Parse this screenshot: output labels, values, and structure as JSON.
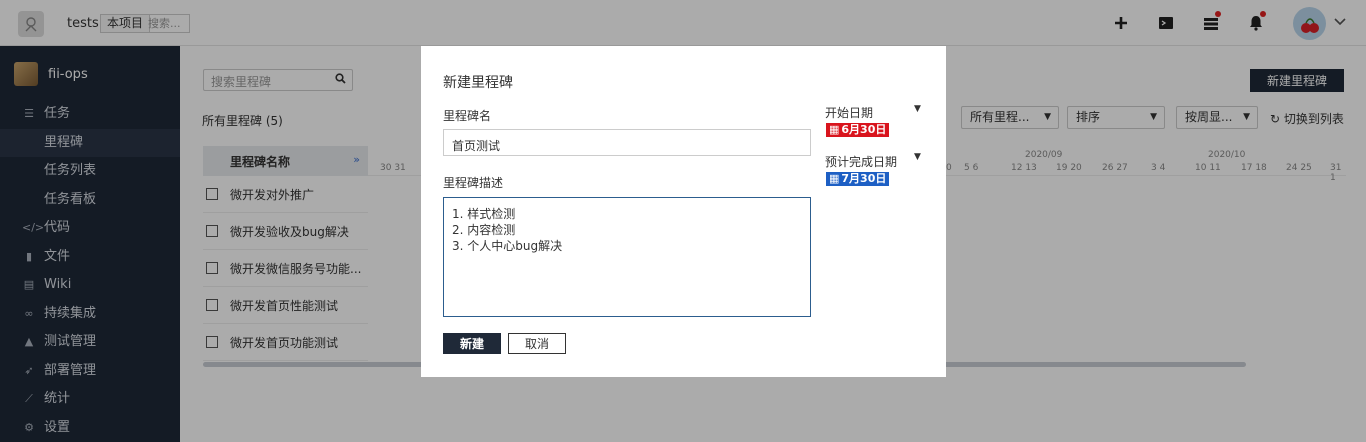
{
  "topbar": {
    "project": "tests",
    "scope": "本项目",
    "search_placeholder": "搜索..."
  },
  "sidebar": {
    "project_name": "fii-ops",
    "items": [
      {
        "label": "任务",
        "icon": "list-icon"
      },
      {
        "label": "里程碑",
        "icon": ""
      },
      {
        "label": "任务列表",
        "icon": ""
      },
      {
        "label": "任务看板",
        "icon": ""
      },
      {
        "label": "代码",
        "icon": "code-icon"
      },
      {
        "label": "文件",
        "icon": "file-icon"
      },
      {
        "label": "Wiki",
        "icon": "wiki-icon"
      },
      {
        "label": "持续集成",
        "icon": "infinity-icon"
      },
      {
        "label": "测试管理",
        "icon": "flask-icon"
      },
      {
        "label": "部署管理",
        "icon": "rocket-icon"
      },
      {
        "label": "统计",
        "icon": "chart-icon"
      },
      {
        "label": "设置",
        "icon": "gear-icon"
      }
    ]
  },
  "main": {
    "search_placeholder": "搜索里程碑",
    "all_milestones": "所有里程碑 (5)",
    "new_milestone": "新建里程碑",
    "filters": [
      "所有里程...",
      "排序",
      "按周显..."
    ],
    "switch_to_list": "切换到列表",
    "table_header": "里程碑名称",
    "rows": [
      "微开发对外推广",
      "微开发验收及bug解决",
      "微开发微信服务号功能...",
      "微开发首页性能测试",
      "微开发首页功能测试"
    ],
    "scale_months": [
      "2020/09",
      "2020/10"
    ],
    "scale_days": [
      "30 31",
      "0",
      "5 6",
      "12 13",
      "19 20",
      "26 27",
      "3 4",
      "10 11",
      "17 18",
      "24 25",
      "31 1"
    ]
  },
  "modal": {
    "title": "新建里程碑",
    "name_label": "里程碑名",
    "name_value": "首页测试",
    "desc_label": "里程碑描述",
    "desc_value": "1. 样式检测\n2. 内容检测\n3. 个人中心bug解决",
    "start_label": "开始日期",
    "start_value": "6月30日",
    "start_color": "#d9141d",
    "end_label": "预计完成日期",
    "end_value": "7月30日",
    "end_color": "#1d5fc4",
    "create_button": "新建",
    "cancel_button": "取消"
  }
}
